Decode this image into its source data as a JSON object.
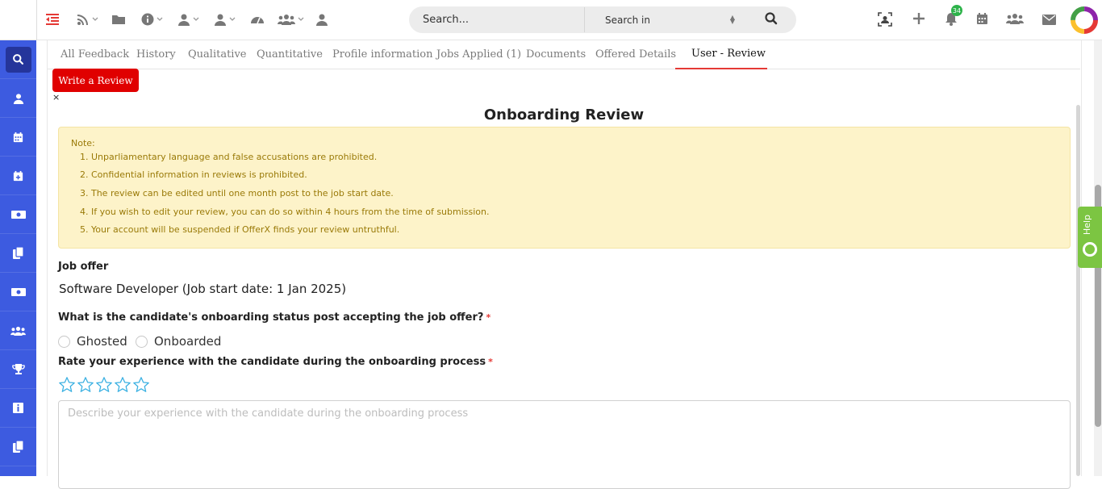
{
  "topbar": {
    "search_placeholder": "Search...",
    "search_in_label": "Search in",
    "notifications_count": "34"
  },
  "icons": {
    "menu": "menu-toggle-icon",
    "feed": "rss-icon",
    "folder": "folder-icon",
    "info": "info-icon",
    "user": "user-icon",
    "dashboard": "gauge-icon",
    "group": "users-icon",
    "notifications": "bell-icon"
  },
  "tabs": [
    {
      "label": "All Feedback"
    },
    {
      "label": "History"
    },
    {
      "label": "Qualitative"
    },
    {
      "label": "Quantitative"
    },
    {
      "label": "Profile information"
    },
    {
      "label": "Jobs Applied (1)"
    },
    {
      "label": "Documents"
    },
    {
      "label": "Offered Details"
    },
    {
      "label": "User - Review",
      "active": true
    }
  ],
  "actions": {
    "write_review": "Write a Review",
    "close": "×"
  },
  "review": {
    "heading": "Onboarding Review",
    "note_title": "Note:",
    "notes": [
      "1. Unparliamentary language and false accusations are prohibited.",
      "2. Confidential information in reviews is prohibited.",
      "3. The review can be edited until one month post to the job start date.",
      "4. If you wish to edit your review, you can do so within 4 hours from the time of submission.",
      "5. Your account will be suspended if OfferX finds your review untruthful."
    ],
    "job_offer_label": "Job offer",
    "job_offer_value": "Software Developer (Job start date: 1 Jan 2025)",
    "status_question": "What is the candidate's onboarding status post accepting the job offer?",
    "required_mark": "*",
    "status_options": [
      "Ghosted",
      "Onboarded"
    ],
    "rating_question": "Rate your experience with the candidate during the onboarding process",
    "rating_value": 0,
    "rating_max": 5,
    "description_placeholder": "Describe your experience with the candidate during the onboarding process"
  },
  "help": {
    "label": "Help"
  },
  "colors": {
    "sidebar": "#3d5be0",
    "accent_red": "#e00000",
    "note_bg": "#fdf3c9",
    "note_text": "#9a7a08",
    "star": "#3ab0e2",
    "help": "#7cc542"
  }
}
